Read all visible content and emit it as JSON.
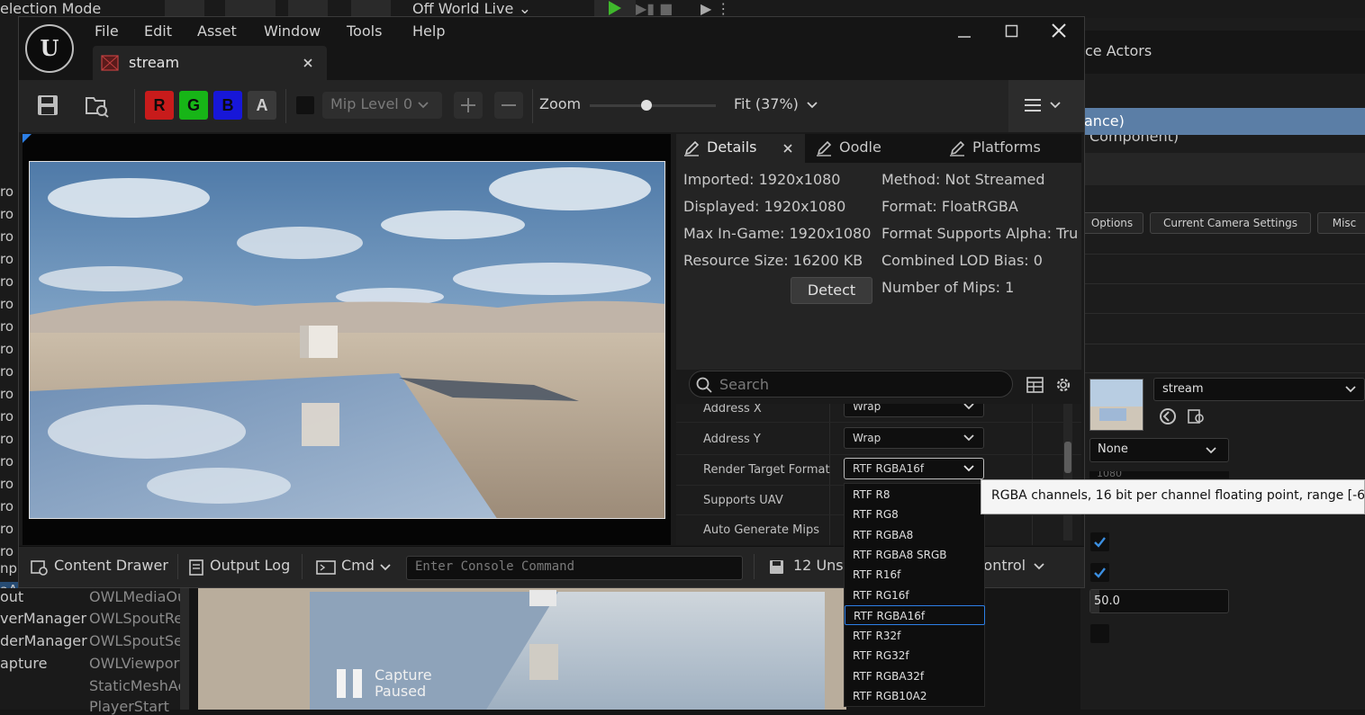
{
  "top_toolbar": {
    "mode_label": "election Mode",
    "world_label": "Off World Live"
  },
  "menu": {
    "file": "File",
    "edit": "Edit",
    "asset": "Asset",
    "window": "Window",
    "tools": "Tools",
    "help": "Help"
  },
  "tab": {
    "title": "stream"
  },
  "toolbar": {
    "r": "R",
    "g": "G",
    "b": "B",
    "a": "A",
    "mip_level": "Mip Level 0",
    "zoom_label": "Zoom",
    "zoom_fit": "Fit (37%)",
    "zoom_value": 0.45
  },
  "details_tabs": {
    "details": "Details",
    "oodle": "Oodle",
    "platforms": "Platforms"
  },
  "info": {
    "imported": "Imported: 1920x1080",
    "displayed": "Displayed: 1920x1080",
    "max_ingame": "Max In-Game: 1920x1080",
    "resource_size": "Resource Size: 16200 KB",
    "detect_button": "Detect",
    "method": "Method: Not Streamed",
    "format": "Format: FloatRGBA",
    "supports_alpha": "Format Supports Alpha: Tru",
    "lod_bias": "Combined LOD Bias: 0",
    "num_mips": "Number of Mips: 1"
  },
  "search": {
    "placeholder": "Search"
  },
  "properties": {
    "address_x": {
      "label": "Address X",
      "value": "Wrap"
    },
    "address_y": {
      "label": "Address Y",
      "value": "Wrap"
    },
    "render_target_format": {
      "label": "Render Target Format",
      "value": "RTF RGBA16f"
    },
    "supports_uav": {
      "label": "Supports UAV"
    },
    "auto_generate_mips": {
      "label": "Auto Generate Mips"
    }
  },
  "dropdown": {
    "options": [
      "RTF R8",
      "RTF RG8",
      "RTF RGBA8",
      "RTF RGBA8 SRGB",
      "RTF R16f",
      "RTF RG16f",
      "RTF RGBA16f",
      "RTF R32f",
      "RTF RG32f",
      "RTF RGBA32f",
      "RTF RGB10A2"
    ],
    "selected": "RTF RGBA16f"
  },
  "tooltip": {
    "text": "RGBA channels, 16 bit per channel floating point, range [-655"
  },
  "bottom_bar": {
    "content_drawer": "Content Drawer",
    "output_log": "Output Log",
    "cmd": "Cmd",
    "console_placeholder": "Enter Console Command",
    "unsaved": "12 Uns",
    "source_control": "n Control"
  },
  "viewport2": {
    "capture_status": "Capture\nPaused"
  },
  "outliner": {
    "rows": [
      {
        "name": "out",
        "type": "OWLMediaOu"
      },
      {
        "name": "verManager",
        "type": "OWLSpoutRe"
      },
      {
        "name": "derManager",
        "type": "OWLSpoutSe"
      },
      {
        "name": "apture",
        "type": "OWLViewport"
      },
      {
        "name": "",
        "type": "StaticMeshAc"
      },
      {
        "name": "",
        "type": "PlayerStart"
      }
    ]
  },
  "left_column": {
    "items": [
      "ro",
      "ro",
      "ro",
      "ro",
      "ro",
      "ro",
      "ro",
      "ro",
      "ro",
      "ro",
      "ro",
      "ro",
      "ro",
      "ro",
      "ro",
      "ro",
      "ro",
      "np",
      "aA"
    ]
  },
  "right_panel": {
    "title": "ce Actors",
    "selected_row": "ance)",
    "row_below": "Component)",
    "buttons": [
      "Options",
      "Current Camera Settings",
      "Misc"
    ],
    "asset_name": "stream",
    "none_label": "None",
    "partial_value": "1080",
    "float_value": "50.0"
  }
}
